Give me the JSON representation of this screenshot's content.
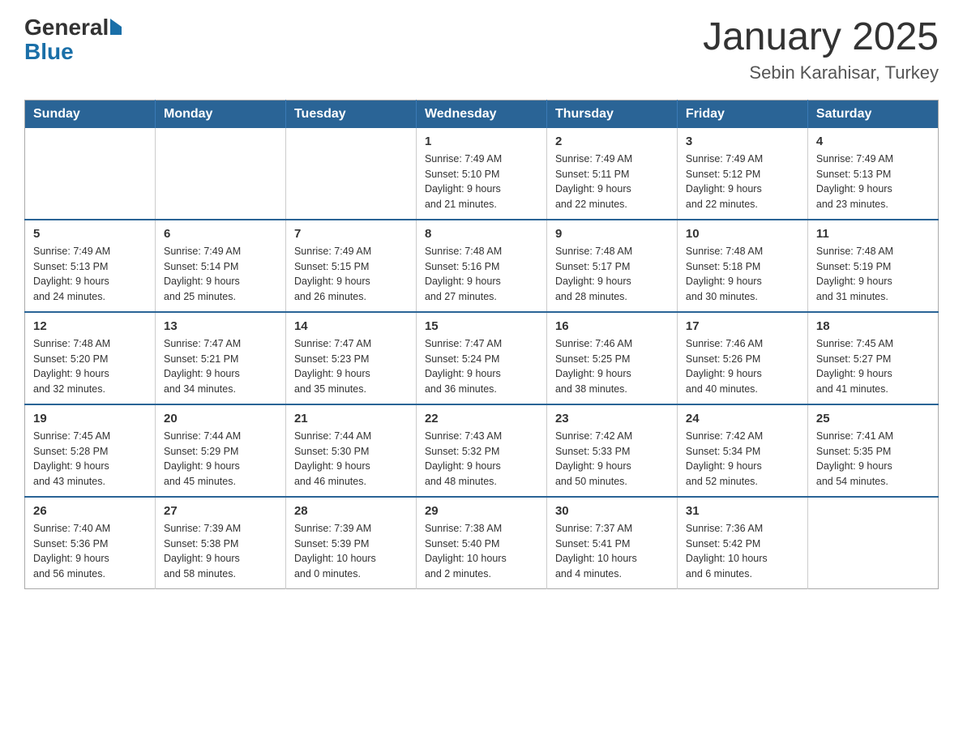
{
  "header": {
    "logo_general": "General",
    "logo_blue": "Blue",
    "title": "January 2025",
    "subtitle": "Sebin Karahisar, Turkey"
  },
  "weekdays": [
    "Sunday",
    "Monday",
    "Tuesday",
    "Wednesday",
    "Thursday",
    "Friday",
    "Saturday"
  ],
  "weeks": [
    [
      {
        "day": "",
        "info": ""
      },
      {
        "day": "",
        "info": ""
      },
      {
        "day": "",
        "info": ""
      },
      {
        "day": "1",
        "info": "Sunrise: 7:49 AM\nSunset: 5:10 PM\nDaylight: 9 hours\nand 21 minutes."
      },
      {
        "day": "2",
        "info": "Sunrise: 7:49 AM\nSunset: 5:11 PM\nDaylight: 9 hours\nand 22 minutes."
      },
      {
        "day": "3",
        "info": "Sunrise: 7:49 AM\nSunset: 5:12 PM\nDaylight: 9 hours\nand 22 minutes."
      },
      {
        "day": "4",
        "info": "Sunrise: 7:49 AM\nSunset: 5:13 PM\nDaylight: 9 hours\nand 23 minutes."
      }
    ],
    [
      {
        "day": "5",
        "info": "Sunrise: 7:49 AM\nSunset: 5:13 PM\nDaylight: 9 hours\nand 24 minutes."
      },
      {
        "day": "6",
        "info": "Sunrise: 7:49 AM\nSunset: 5:14 PM\nDaylight: 9 hours\nand 25 minutes."
      },
      {
        "day": "7",
        "info": "Sunrise: 7:49 AM\nSunset: 5:15 PM\nDaylight: 9 hours\nand 26 minutes."
      },
      {
        "day": "8",
        "info": "Sunrise: 7:48 AM\nSunset: 5:16 PM\nDaylight: 9 hours\nand 27 minutes."
      },
      {
        "day": "9",
        "info": "Sunrise: 7:48 AM\nSunset: 5:17 PM\nDaylight: 9 hours\nand 28 minutes."
      },
      {
        "day": "10",
        "info": "Sunrise: 7:48 AM\nSunset: 5:18 PM\nDaylight: 9 hours\nand 30 minutes."
      },
      {
        "day": "11",
        "info": "Sunrise: 7:48 AM\nSunset: 5:19 PM\nDaylight: 9 hours\nand 31 minutes."
      }
    ],
    [
      {
        "day": "12",
        "info": "Sunrise: 7:48 AM\nSunset: 5:20 PM\nDaylight: 9 hours\nand 32 minutes."
      },
      {
        "day": "13",
        "info": "Sunrise: 7:47 AM\nSunset: 5:21 PM\nDaylight: 9 hours\nand 34 minutes."
      },
      {
        "day": "14",
        "info": "Sunrise: 7:47 AM\nSunset: 5:23 PM\nDaylight: 9 hours\nand 35 minutes."
      },
      {
        "day": "15",
        "info": "Sunrise: 7:47 AM\nSunset: 5:24 PM\nDaylight: 9 hours\nand 36 minutes."
      },
      {
        "day": "16",
        "info": "Sunrise: 7:46 AM\nSunset: 5:25 PM\nDaylight: 9 hours\nand 38 minutes."
      },
      {
        "day": "17",
        "info": "Sunrise: 7:46 AM\nSunset: 5:26 PM\nDaylight: 9 hours\nand 40 minutes."
      },
      {
        "day": "18",
        "info": "Sunrise: 7:45 AM\nSunset: 5:27 PM\nDaylight: 9 hours\nand 41 minutes."
      }
    ],
    [
      {
        "day": "19",
        "info": "Sunrise: 7:45 AM\nSunset: 5:28 PM\nDaylight: 9 hours\nand 43 minutes."
      },
      {
        "day": "20",
        "info": "Sunrise: 7:44 AM\nSunset: 5:29 PM\nDaylight: 9 hours\nand 45 minutes."
      },
      {
        "day": "21",
        "info": "Sunrise: 7:44 AM\nSunset: 5:30 PM\nDaylight: 9 hours\nand 46 minutes."
      },
      {
        "day": "22",
        "info": "Sunrise: 7:43 AM\nSunset: 5:32 PM\nDaylight: 9 hours\nand 48 minutes."
      },
      {
        "day": "23",
        "info": "Sunrise: 7:42 AM\nSunset: 5:33 PM\nDaylight: 9 hours\nand 50 minutes."
      },
      {
        "day": "24",
        "info": "Sunrise: 7:42 AM\nSunset: 5:34 PM\nDaylight: 9 hours\nand 52 minutes."
      },
      {
        "day": "25",
        "info": "Sunrise: 7:41 AM\nSunset: 5:35 PM\nDaylight: 9 hours\nand 54 minutes."
      }
    ],
    [
      {
        "day": "26",
        "info": "Sunrise: 7:40 AM\nSunset: 5:36 PM\nDaylight: 9 hours\nand 56 minutes."
      },
      {
        "day": "27",
        "info": "Sunrise: 7:39 AM\nSunset: 5:38 PM\nDaylight: 9 hours\nand 58 minutes."
      },
      {
        "day": "28",
        "info": "Sunrise: 7:39 AM\nSunset: 5:39 PM\nDaylight: 10 hours\nand 0 minutes."
      },
      {
        "day": "29",
        "info": "Sunrise: 7:38 AM\nSunset: 5:40 PM\nDaylight: 10 hours\nand 2 minutes."
      },
      {
        "day": "30",
        "info": "Sunrise: 7:37 AM\nSunset: 5:41 PM\nDaylight: 10 hours\nand 4 minutes."
      },
      {
        "day": "31",
        "info": "Sunrise: 7:36 AM\nSunset: 5:42 PM\nDaylight: 10 hours\nand 6 minutes."
      },
      {
        "day": "",
        "info": ""
      }
    ]
  ]
}
